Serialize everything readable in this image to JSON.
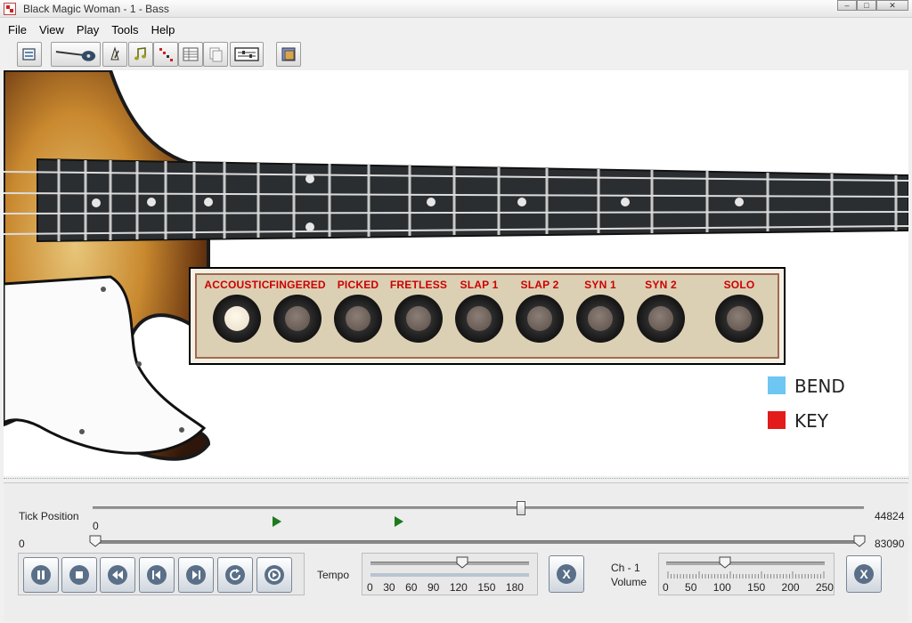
{
  "window": {
    "title": "Black Magic Woman - 1 - Bass"
  },
  "menu": [
    "File",
    "View",
    "Play",
    "Tools",
    "Help"
  ],
  "toolbar": {
    "icons": [
      "open-file-icon",
      "bass-guitar-icon",
      "metronome-icon",
      "music-note-icon",
      "diagonal-notes-icon",
      "score-grid-icon",
      "copy-pages-icon",
      "track-view-icon",
      "settings-icon"
    ]
  },
  "sounds": {
    "selected": "ACCOUSTIC",
    "items": [
      "ACCOUSTIC",
      "FINGERED",
      "PICKED",
      "FRETLESS",
      "SLAP 1",
      "SLAP 2",
      "SYN 1",
      "SYN 2",
      "SOLO"
    ]
  },
  "legend": [
    {
      "label": "BEND",
      "color": "#6ec6f2"
    },
    {
      "label": "KEY",
      "color": "#e31b1b"
    }
  ],
  "tick_position": {
    "label": "Tick Position",
    "current_label": "0",
    "max_label": "44824",
    "fraction": 0.555
  },
  "range": {
    "start_label": "0",
    "end_label": "83090"
  },
  "transport": {
    "buttons": [
      "pause-icon",
      "stop-icon",
      "rewind-icon",
      "previous-icon",
      "next-icon",
      "loop-icon",
      "record-icon"
    ]
  },
  "tempo": {
    "label": "Tempo",
    "value": 120,
    "ticks": [
      "0",
      "30",
      "60",
      "90",
      "120",
      "150",
      "180"
    ]
  },
  "volume": {
    "channel_label": "Ch - 1",
    "label": "Volume",
    "value": 100,
    "ticks": [
      "0",
      "50",
      "100",
      "150",
      "200",
      "250"
    ]
  },
  "reset_label": "X",
  "colors": {
    "accent_red": "#c00000",
    "panel_tan": "#dcd0b4",
    "marker_green": "#1d7a1d"
  }
}
